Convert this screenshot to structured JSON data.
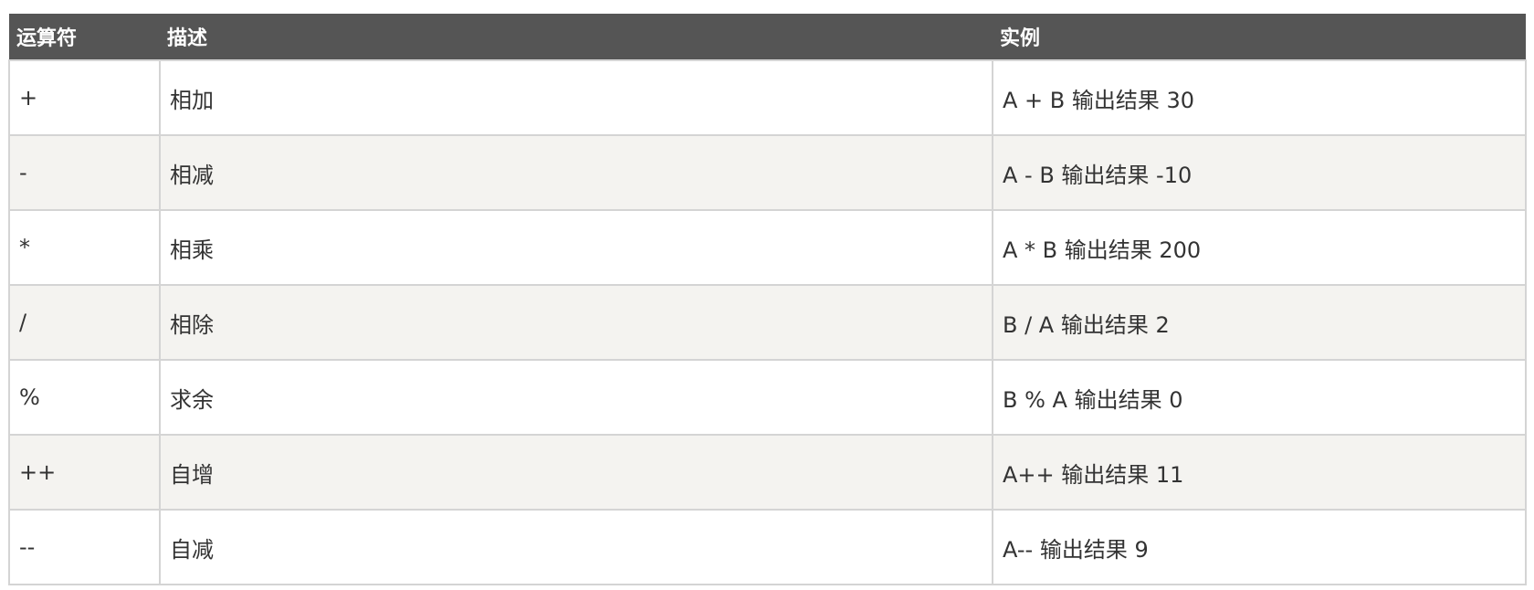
{
  "table": {
    "headers": [
      "运算符",
      "描述",
      "实例"
    ],
    "rows": [
      [
        "+",
        "相加",
        "A + B 输出结果 30"
      ],
      [
        "-",
        "相减",
        "A - B 输出结果 -10"
      ],
      [
        "*",
        "相乘",
        "A * B 输出结果 200"
      ],
      [
        "/",
        "相除",
        "B / A 输出结果 2"
      ],
      [
        "%",
        "求余",
        "B % A 输出结果 0"
      ],
      [
        "++",
        "自增",
        "A++ 输出结果 11"
      ],
      [
        "--",
        "自减",
        "A-- 输出结果 9"
      ]
    ]
  },
  "colors": {
    "header_bg": "#555555",
    "header_text": "#ffffff",
    "row_alt_bg": "#f4f3f0",
    "border": "#d4d4d4"
  }
}
